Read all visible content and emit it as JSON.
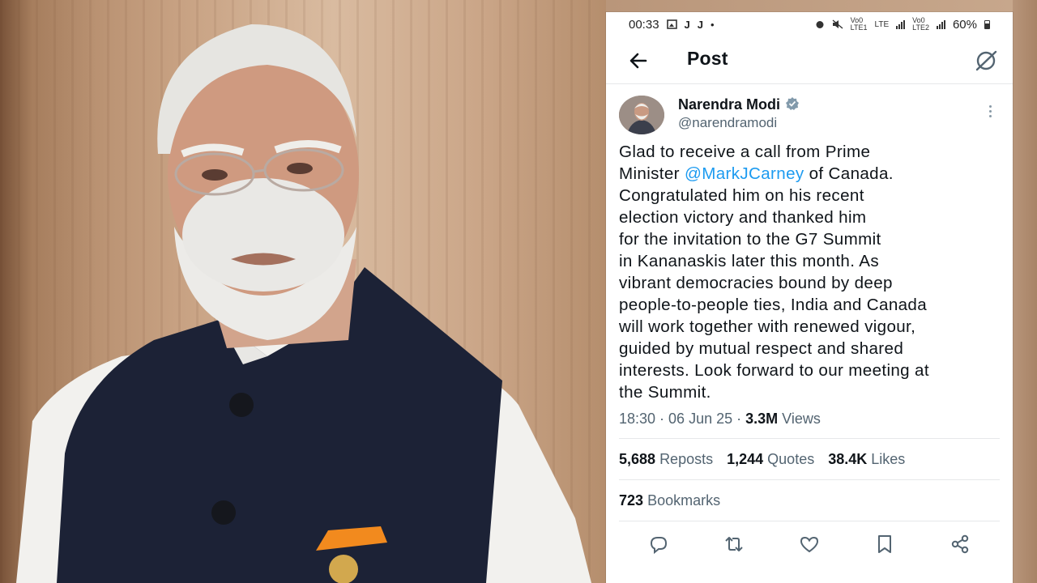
{
  "status_bar": {
    "time": "00:33",
    "icons_left": [
      "gallery-icon",
      "j-icon",
      "j-icon",
      "dot-icon"
    ],
    "net1": "Vo0\nLTE1",
    "lte": "LTE",
    "net2": "Vo0\nLTE2",
    "battery": "60%"
  },
  "header": {
    "title": "Post"
  },
  "author": {
    "name": "Narendra Modi",
    "handle": "@narendramodi"
  },
  "tweet": {
    "line1": "Glad to receive a call from Prime",
    "line2_pre": "Minister ",
    "mention": "@MarkJCarney",
    "line2_post": " of Canada.",
    "rest": "Congratulated him on his recent\nelection victory and thanked him\nfor the invitation to the G7 Summit\nin Kananaskis later this month. As\nvibrant democracies bound by deep\npeople-to-people ties, India and Canada\nwill work together with renewed vigour,\nguided by mutual respect and shared\ninterests. Look forward to our meeting at\nthe Summit."
  },
  "meta": {
    "time": "18:30",
    "date": "06 Jun 25",
    "views_count": "3.3M",
    "views_label": "Views"
  },
  "stats": {
    "reposts_count": "5,688",
    "reposts_label": "Reposts",
    "quotes_count": "1,244",
    "quotes_label": "Quotes",
    "likes_count": "38.4K",
    "likes_label": "Likes",
    "bookmarks_count": "723",
    "bookmarks_label": "Bookmarks"
  },
  "actions": [
    "reply-icon",
    "repost-icon",
    "like-icon",
    "bookmark-icon",
    "share-icon"
  ],
  "colors": {
    "accent": "#1d9bf0",
    "text": "#0f1419",
    "secondary": "#536471"
  }
}
